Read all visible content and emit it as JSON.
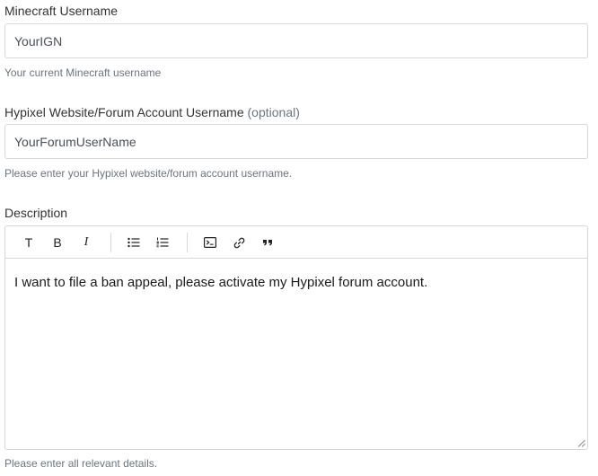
{
  "minecraft": {
    "label": "Minecraft Username",
    "value": "YourIGN",
    "help": "Your current Minecraft username"
  },
  "forum": {
    "label": "Hypixel Website/Forum Account Username",
    "optional": "(optional)",
    "value": "YourForumUserName",
    "help": "Please enter your Hypixel website/forum account username."
  },
  "description": {
    "label": "Description",
    "content": "I want to file a ban appeal, please activate my Hypixel forum account.",
    "help": "Please enter all relevant details.",
    "toolbar": {
      "text_style": "T",
      "bold": "B",
      "italic": "I",
      "icons": [
        "text-style-icon",
        "bold-icon",
        "italic-icon",
        "bulleted-list-icon",
        "numbered-list-icon",
        "code-block-icon",
        "link-icon",
        "quote-icon"
      ]
    }
  },
  "colors": {
    "border": "#d6d9dc",
    "help_text": "#6c757d",
    "label_text": "#333333"
  }
}
